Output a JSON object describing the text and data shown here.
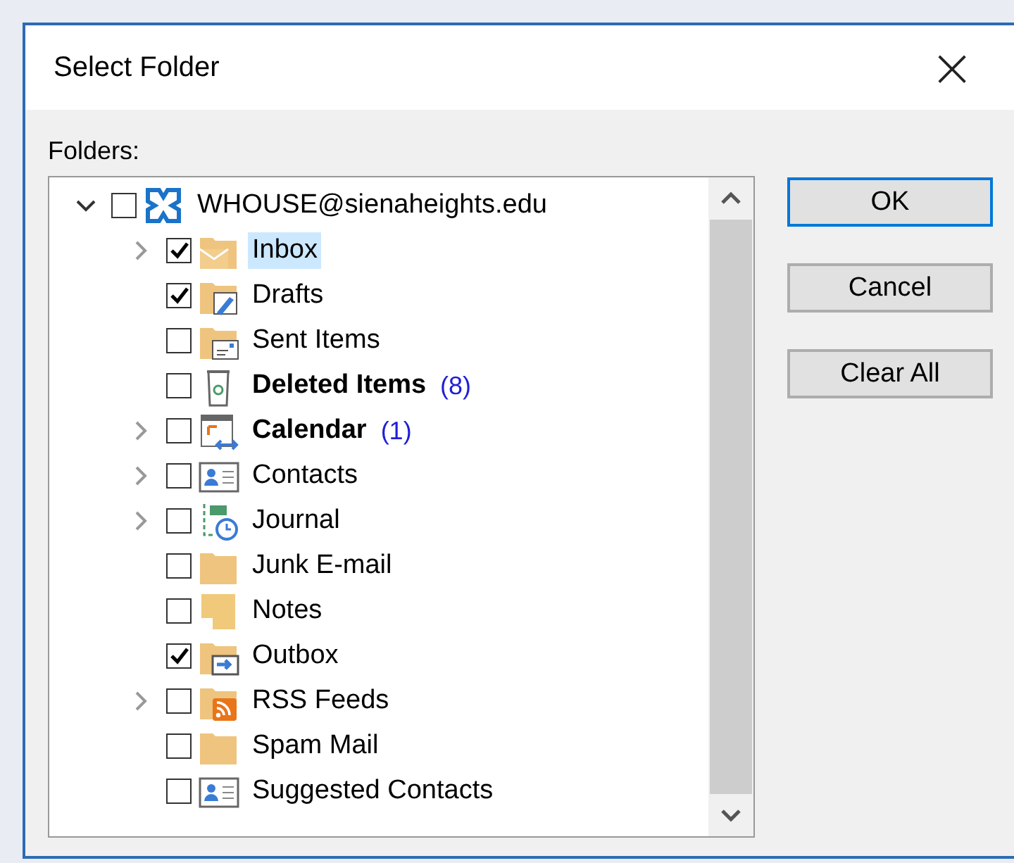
{
  "window": {
    "title": "Select Folder",
    "close": "×"
  },
  "folders_label": "Folders:",
  "tree": {
    "root": {
      "name": "WHOUSE@sienaheights.edu",
      "kind": "mailbox",
      "expanded": true,
      "checked": false,
      "selected": false,
      "bold": false,
      "children": [
        {
          "name": "Inbox",
          "kind": "inbox",
          "expandable": true,
          "expanded": false,
          "checked": true,
          "selected": true,
          "bold": false
        },
        {
          "name": "Drafts",
          "kind": "drafts",
          "expandable": false,
          "expanded": false,
          "checked": true,
          "selected": false,
          "bold": false
        },
        {
          "name": "Sent Items",
          "kind": "sent",
          "expandable": false,
          "expanded": false,
          "checked": false,
          "selected": false,
          "bold": false
        },
        {
          "name": "Deleted Items",
          "kind": "deleted",
          "expandable": false,
          "expanded": false,
          "checked": false,
          "selected": false,
          "bold": true,
          "count": "(8)"
        },
        {
          "name": "Calendar",
          "kind": "calendar",
          "expandable": true,
          "expanded": false,
          "checked": false,
          "selected": false,
          "bold": true,
          "count": "(1)"
        },
        {
          "name": "Contacts",
          "kind": "contacts",
          "expandable": true,
          "expanded": false,
          "checked": false,
          "selected": false,
          "bold": false
        },
        {
          "name": "Journal",
          "kind": "journal",
          "expandable": true,
          "expanded": false,
          "checked": false,
          "selected": false,
          "bold": false
        },
        {
          "name": "Junk E-mail",
          "kind": "folder",
          "expandable": false,
          "expanded": false,
          "checked": false,
          "selected": false,
          "bold": false
        },
        {
          "name": "Notes",
          "kind": "notes",
          "expandable": false,
          "expanded": false,
          "checked": false,
          "selected": false,
          "bold": false
        },
        {
          "name": "Outbox",
          "kind": "outbox",
          "expandable": false,
          "expanded": false,
          "checked": true,
          "selected": false,
          "bold": false
        },
        {
          "name": "RSS Feeds",
          "kind": "rss",
          "expandable": true,
          "expanded": false,
          "checked": false,
          "selected": false,
          "bold": false
        },
        {
          "name": "Spam Mail",
          "kind": "folder",
          "expandable": false,
          "expanded": false,
          "checked": false,
          "selected": false,
          "bold": false
        },
        {
          "name": "Suggested Contacts",
          "kind": "contacts",
          "expandable": false,
          "expanded": false,
          "checked": false,
          "selected": false,
          "bold": false
        }
      ]
    }
  },
  "buttons": [
    {
      "label": "OK",
      "default": true
    },
    {
      "label": "Cancel",
      "default": false
    },
    {
      "label": "Clear All",
      "default": false
    }
  ]
}
